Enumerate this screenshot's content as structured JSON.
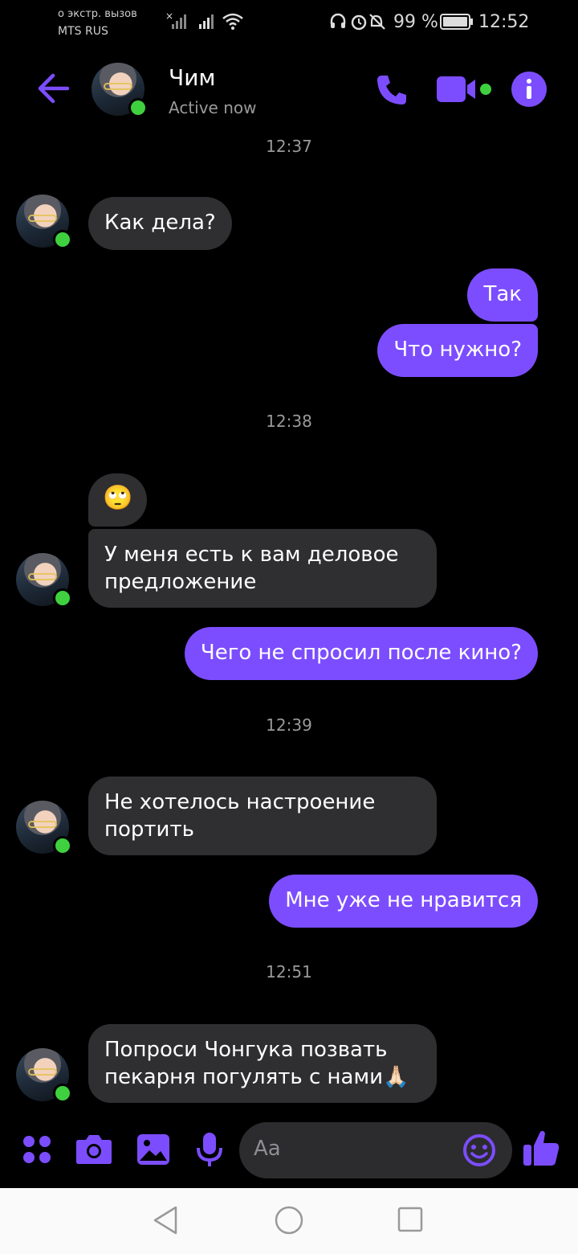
{
  "status_bar": {
    "emergency_text": "о экстр. вызов",
    "carrier": "MTS RUS",
    "battery": "99 %",
    "time": "12:52"
  },
  "header": {
    "contact_name": "Чим",
    "status": "Active now",
    "icons": [
      "back-arrow-icon",
      "phone-icon",
      "video-camera-icon",
      "info-icon"
    ],
    "accent_color": "#7c4dff"
  },
  "messages": [
    {
      "type": "time",
      "text": "12:37"
    },
    {
      "type": "in",
      "text": "Как дела?"
    },
    {
      "type": "out",
      "text": "Так"
    },
    {
      "type": "out",
      "text": "Что нужно?"
    },
    {
      "type": "time",
      "text": "12:38"
    },
    {
      "type": "in",
      "text": "🙄"
    },
    {
      "type": "in",
      "text": "У меня есть к вам деловое предложение"
    },
    {
      "type": "out",
      "text": "Чего не спросил после кино?"
    },
    {
      "type": "time",
      "text": "12:39"
    },
    {
      "type": "in",
      "text": "Не хотелось настроение портить"
    },
    {
      "type": "out",
      "text": "Мне уже не нравится"
    },
    {
      "type": "time",
      "text": "12:51"
    },
    {
      "type": "in",
      "text": "Попроси Чонгука позвать пекарня погулять с нами🙏🏻"
    }
  ],
  "composer": {
    "placeholder": "Aa",
    "icons": [
      "apps-grid-icon",
      "camera-icon",
      "gallery-icon",
      "microphone-icon",
      "emoji-icon",
      "thumbs-up-icon"
    ]
  },
  "nav_bar": {
    "icons": [
      "back-triangle-icon",
      "home-circle-icon",
      "recents-square-icon"
    ]
  }
}
